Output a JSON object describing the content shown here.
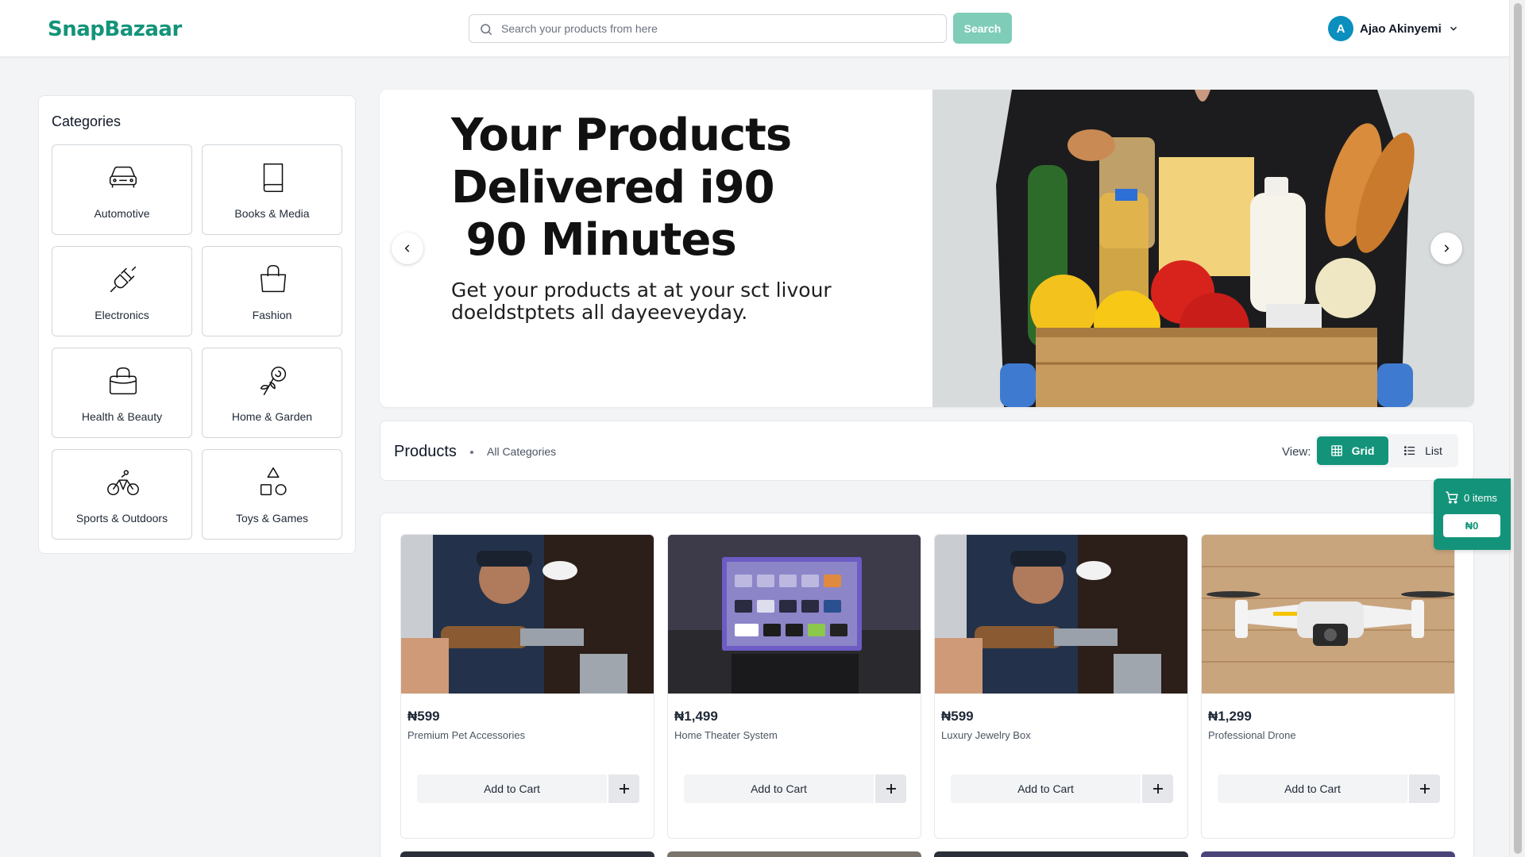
{
  "header": {
    "logo": "SnapBazaar",
    "search_placeholder": "Search your products from here",
    "search_button": "Search",
    "user_initial": "A",
    "user_name": "Ajao Akinyemi"
  },
  "categories": {
    "title": "Categories",
    "items": [
      {
        "label": "Automotive",
        "icon": "car-icon"
      },
      {
        "label": "Books & Media",
        "icon": "book-icon"
      },
      {
        "label": "Electronics",
        "icon": "plug-icon"
      },
      {
        "label": "Fashion",
        "icon": "shopping-bag-icon"
      },
      {
        "label": "Health & Beauty",
        "icon": "handbag-icon"
      },
      {
        "label": "Home & Garden",
        "icon": "rose-icon"
      },
      {
        "label": "Sports & Outdoors",
        "icon": "bicycle-icon"
      },
      {
        "label": "Toys & Games",
        "icon": "shapes-icon"
      }
    ]
  },
  "banner": {
    "title_line1": "Your Products",
    "title_line2": "Delivered i90",
    "title_line3": " 90 Minutes",
    "subtitle_line1": "Get your products at at your sct livour",
    "subtitle_line2": "doeldstptets all dayeeveyday."
  },
  "products_bar": {
    "title": "Products",
    "category": "All Categories",
    "view_label": "View:",
    "grid_label": "Grid",
    "list_label": "List"
  },
  "cart": {
    "items_label": "0 items",
    "total": "₦0"
  },
  "products": [
    {
      "price": "₦599",
      "name": "Premium Pet Accessories",
      "button": "Add to Cart"
    },
    {
      "price": "₦1,499",
      "name": "Home Theater System",
      "button": "Add to Cart"
    },
    {
      "price": "₦599",
      "name": "Luxury Jewelry Box",
      "button": "Add to Cart"
    },
    {
      "price": "₦1,299",
      "name": "Professional Drone",
      "button": "Add to Cart"
    }
  ],
  "colors": {
    "brand": "#13947a",
    "search_button": "#7fcdb9",
    "avatar": "#0c8fbf"
  }
}
